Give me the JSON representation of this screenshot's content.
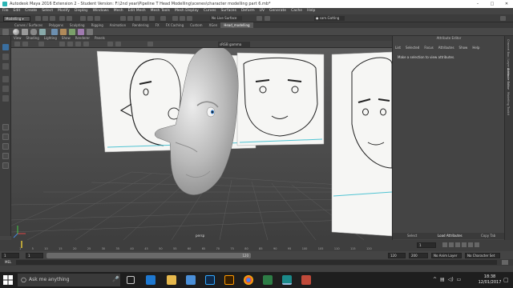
{
  "window": {
    "title": "Autodesk Maya 2016 Extension 2 - Student Version: F:\\2nd year\\Pipeline T Head Modelling\\scenes\\character modelling part 6.mb*",
    "minimize": "–",
    "maximize": "□",
    "close": "✕"
  },
  "menubar": [
    "File",
    "Edit",
    "Create",
    "Select",
    "Modify",
    "Display",
    "Windows",
    "Mesh",
    "Edit Mesh",
    "Mesh Tools",
    "Mesh Display",
    "Curves",
    "Surfaces",
    "Deform",
    "UV",
    "Generate",
    "Cache",
    "Help"
  ],
  "statusline": {
    "mode": "Modelling",
    "live_surface": "No Live Surface",
    "login": "sam.Gatting"
  },
  "shelf_tabs": [
    "Curves / Surfaces",
    "Polygons",
    "Sculpting",
    "Rigging",
    "Animation",
    "Rendering",
    "FX",
    "FX Caching",
    "Custom",
    "XGen",
    "Head_modelling"
  ],
  "shelf_active": "Head_modelling",
  "panel_menu": [
    "View",
    "Shading",
    "Lighting",
    "Show",
    "Renderer",
    "Panels"
  ],
  "viewport": {
    "gamma": "sRGB gamma",
    "camera_label": "persp"
  },
  "attribute_editor": {
    "title": "Attribute Editor",
    "menu": [
      "List",
      "Selected",
      "Focus",
      "Attributes",
      "Show",
      "Help"
    ],
    "hint": "Make a selection to view attributes.",
    "bottom_buttons": [
      "Select",
      "Load Attributes",
      "Copy Tab"
    ]
  },
  "side_tabs": [
    "Channel Box / Layer Editor",
    "Attribute Editor",
    "Modelling Toolkit"
  ],
  "timeline": {
    "ticks": [
      "1",
      "5",
      "10",
      "15",
      "20",
      "25",
      "30",
      "35",
      "40",
      "45",
      "50",
      "55",
      "60",
      "65",
      "70",
      "75",
      "80",
      "85",
      "90",
      "95",
      "100",
      "105",
      "110",
      "115",
      "120"
    ],
    "current_frame": "1"
  },
  "range": {
    "start": "1",
    "inner_start": "1",
    "inner_end": "120",
    "end": "120",
    "max": "200",
    "anim_layer": "No Anim Layer",
    "char_set": "No Character Set"
  },
  "cmdline": {
    "label": "MEL"
  },
  "taskbar": {
    "search_placeholder": "Ask me anything",
    "time": "18:38",
    "date": "12/01/2017"
  },
  "colors": {
    "maya_accent": "#2cb5b5",
    "timeline_marker": "#b8a23a",
    "taskbar": "#1e1e1e"
  }
}
